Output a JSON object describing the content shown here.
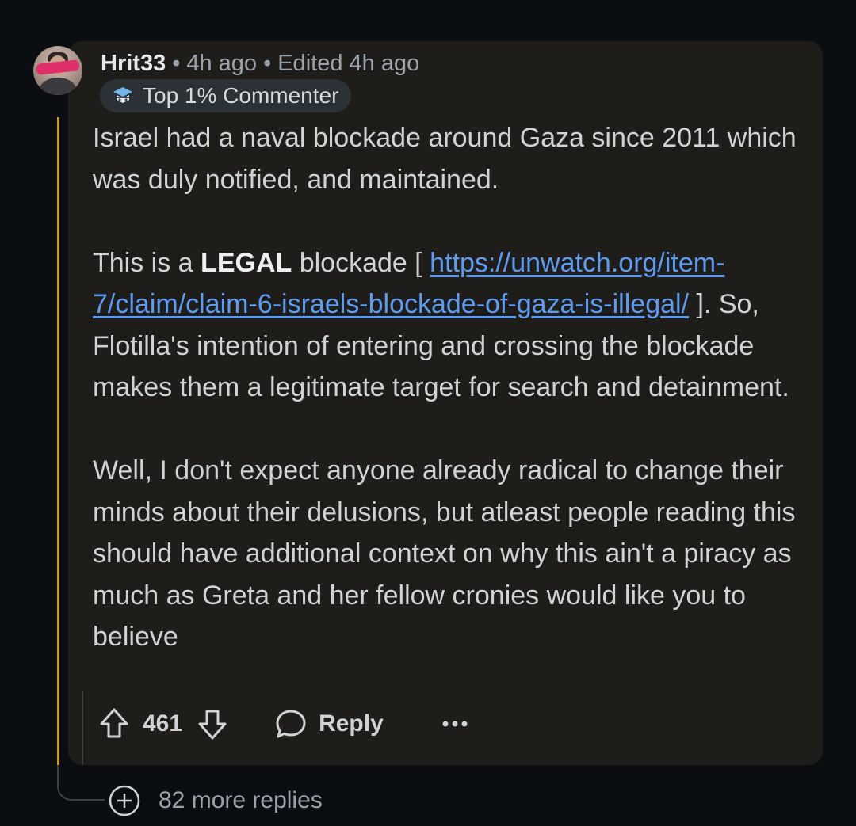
{
  "comment": {
    "author": "Hrit33",
    "separator": "•",
    "time": "4h ago",
    "edited": "Edited 4h ago",
    "flair": "Top 1% Commenter",
    "body": {
      "p1": "Israel had a naval blockade around Gaza since 2011 which was duly notified, and maintained.",
      "p2_prefix": "This is a ",
      "p2_bold": "LEGAL",
      "p2_mid": " blockade [ ",
      "p2_link": "https://unwatch.org/item-7/claim/claim-6-israels-blockade-of-gaza-is-illegal/",
      "p2_suffix": " ]. So, Flotilla's intention of entering and crossing the blockade makes them a legitimate target for search and detainment.",
      "p3": "Well, I don't expect anyone already radical to change their minds about their delusions, but atleast people reading this should have additional context on why this ain't a piracy as much as Greta and her fellow cronies would like you to believe"
    },
    "votes": "461",
    "reply_label": "Reply"
  },
  "more_replies": "82 more replies",
  "icons": {
    "upvote": "arrow-up-icon",
    "downvote": "arrow-down-icon",
    "reply": "speech-bubble-icon",
    "more": "ellipsis-icon",
    "expand": "plus-circle-icon",
    "flair": "achievement-badge-icon"
  },
  "colors": {
    "background": "#0b0e11",
    "card": "#1f1d1a",
    "thread_line": "#c99a14",
    "link": "#5d9bf0",
    "redaction": "#e0306c"
  }
}
